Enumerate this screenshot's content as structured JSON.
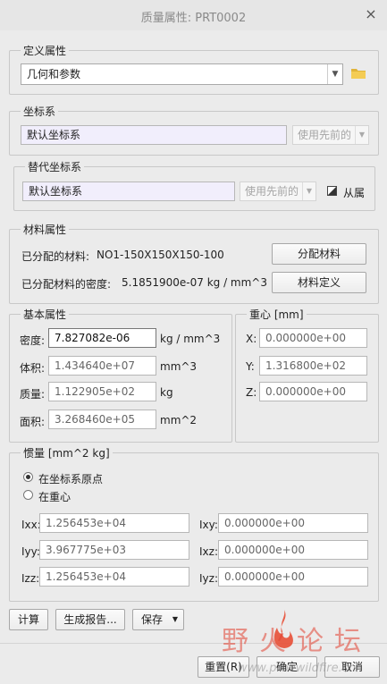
{
  "window": {
    "title": "质量属性: PRT0002",
    "close_symbol": "×"
  },
  "define_props": {
    "title": "定义属性",
    "mode_value": "几何和参数"
  },
  "coord_sys": {
    "title": "坐标系",
    "value": "默认坐标系",
    "option": "使用先前的"
  },
  "alt_coord": {
    "title": "替代坐标系",
    "value": "默认坐标系",
    "option": "使用先前的",
    "from_layer": "从属"
  },
  "material": {
    "title": "材料属性",
    "assigned_label": "已分配的材料:",
    "assigned_value": "NO1-150X150X150-100",
    "density_label": "已分配材料的密度:",
    "density_value": "5.1851900e-07  kg / mm^3",
    "assign_btn": "分配材料",
    "define_btn": "材料定义"
  },
  "basic": {
    "title": "基本属性",
    "rows": [
      {
        "label": "密度:",
        "value": "7.827082e-06",
        "unit": "kg / mm^3"
      },
      {
        "label": "体积:",
        "value": "1.434640e+07",
        "unit": "mm^3"
      },
      {
        "label": "质量:",
        "value": "1.122905e+02",
        "unit": "kg"
      },
      {
        "label": "面积:",
        "value": "3.268460e+05",
        "unit": "mm^2"
      }
    ]
  },
  "center": {
    "title": "重心 [mm]",
    "rows": [
      {
        "label": "X:",
        "value": "0.000000e+00"
      },
      {
        "label": "Y:",
        "value": "1.316800e+02"
      },
      {
        "label": "Z:",
        "value": "0.000000e+00"
      }
    ]
  },
  "inertia": {
    "title": "惯量 [mm^2 kg]",
    "radio_origin": "在坐标系原点",
    "radio_center": "在重心",
    "rows": [
      {
        "l1": "Ixx:",
        "v1": "1.256453e+04",
        "l2": "Ixy:",
        "v2": "0.000000e+00"
      },
      {
        "l1": "Iyy:",
        "v1": "3.967775e+03",
        "l2": "Ixz:",
        "v2": "0.000000e+00"
      },
      {
        "l1": "Izz:",
        "v1": "1.256453e+04",
        "l2": "Iyz:",
        "v2": "0.000000e+00"
      }
    ]
  },
  "bottom": {
    "calc": "计算",
    "report": "生成报告...",
    "save": "保存",
    "reset": "重置(R)",
    "ok": "确定",
    "cancel": "取消"
  },
  "watermark": {
    "text": "野火论坛",
    "url": "www.proewildfire.cn"
  }
}
